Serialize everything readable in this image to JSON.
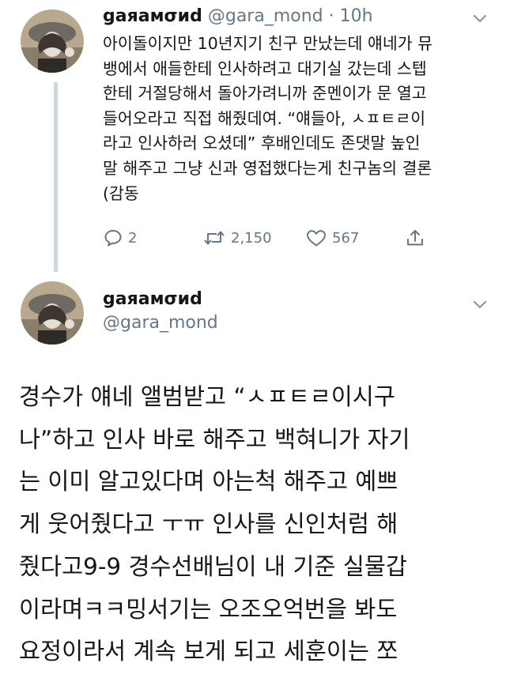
{
  "tweet1": {
    "display_name": "gaяaмσиd",
    "handle": "@gara_mond",
    "separator": "·",
    "time": "10h",
    "lines": [
      "아이돌이지만 10년지기 친구 만났는데 얘네가 뮤",
      "뱅에서 애들한테 인사하려고 대기실 갔는데 스텝",
      "한테 거절당해서 돌아가려니까 준멘이가 문 열고",
      "들어오라고 직접 해줬데여. “얘들아, ㅅㅍㅌㄹ이",
      "라고 인사하러 오셨데” 후배인데도 존댓말 높인",
      "말 해주고 그냥 신과 영접했다는게 친구놈의 결론",
      "(감동"
    ],
    "actions": {
      "reply_count": "2",
      "retweet_count": "2,150",
      "like_count": "567"
    }
  },
  "tweet2": {
    "display_name": "gaяaмσиd",
    "handle": "@gara_mond",
    "lines": [
      "경수가 얘네 앨범받고 “ㅅㅍㅌㄹ이시구",
      "나”하고 인사 바로 해주고 백혀니가 자기",
      "는 이미 알고있다며 아는척 해주고 예쁘",
      "게 웃어줬다고 ㅜㅠ 인사를 신인처럼 해",
      "줬다고9-9 경수선배님이 내 기준 실물갑",
      "이라며ㅋㅋ밍서기는 오조오억번을 봐도",
      "요정이라서 계속 보게 되고 세훈이는 쪼"
    ]
  },
  "icons": {
    "reply": "reply-icon",
    "retweet": "retweet-icon",
    "like": "heart-icon",
    "share": "share-icon",
    "caret": "chevron-down-icon"
  },
  "colors": {
    "text": "#14171a",
    "muted": "#657786",
    "thread_line": "#ccd6dd"
  }
}
